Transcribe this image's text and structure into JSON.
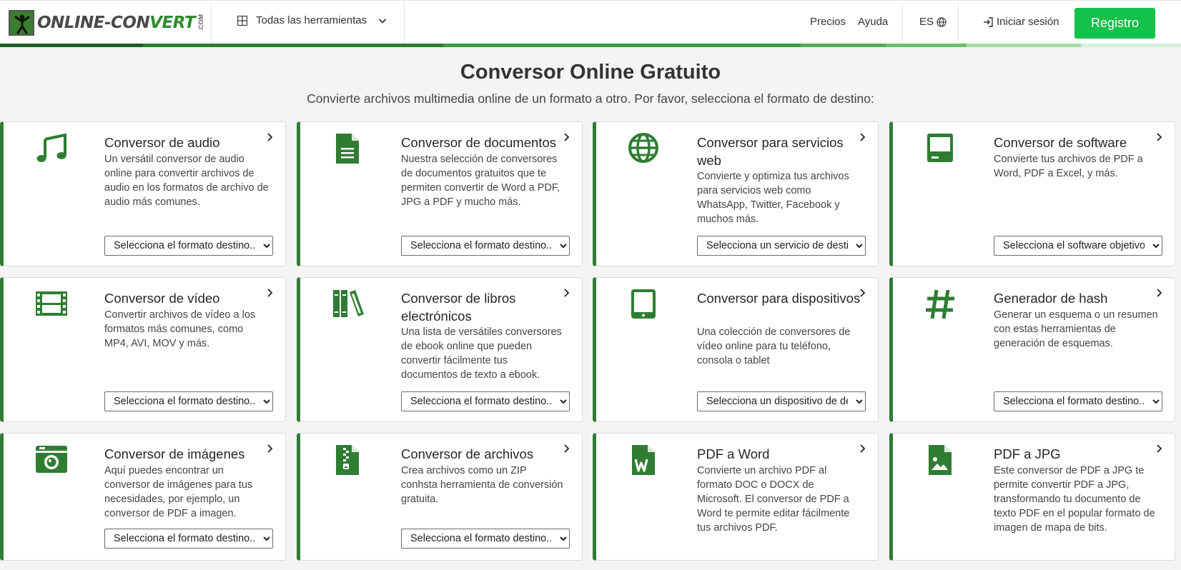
{
  "brand": {
    "name_part1": "ONLINE-CON",
    "name_part2": "VERT",
    "suffix": ".COM"
  },
  "header": {
    "tools_menu_label": "Todas las herramientas",
    "pricing_label": "Precios",
    "help_label": "Ayuda",
    "language_label": "ES",
    "login_label": "Iniciar sesión",
    "register_label": "Registro"
  },
  "colors": {
    "accent_green": "#2f7d32",
    "register_green": "#13c24a",
    "background": "#f4f4f4"
  },
  "hero": {
    "title": "Conversor Online Gratuito",
    "subtitle": "Convierte archivos multimedia online de un formato a otro. Por favor, selecciona el formato de destino:"
  },
  "cards": [
    {
      "icon": "music-note-icon",
      "title": "Conversor de audio",
      "description": "Un versátil conversor de audio online para convertir archivos de audio en los formatos de archivo de audio más comunes.",
      "select_placeholder": "Selecciona el formato destino..."
    },
    {
      "icon": "document-icon",
      "title": "Conversor de documentos",
      "description": "Nuestra selección de conversores de documentos gratuitos que te permiten convertir de Word a PDF, JPG a PDF y mucho más.",
      "select_placeholder": "Selecciona el formato destino..."
    },
    {
      "icon": "globe-icon",
      "title": "Conversor para servicios web",
      "description": "Convierte y optimiza tus archivos para servicios web como WhatsApp, Twitter, Facebook y muchos más.",
      "select_placeholder": "Selecciona un servicio de destino..."
    },
    {
      "icon": "computer-icon",
      "title": "Conversor de software",
      "description": "Convierte tus archivos de PDF a Word, PDF a Excel, y más.",
      "select_placeholder": "Selecciona el software objetivo..."
    },
    {
      "icon": "film-icon",
      "title": "Conversor de vídeo",
      "description": "Convertir archivos de vídeo a los formatos más comunes, como MP4, AVI, MOV y más.",
      "select_placeholder": "Selecciona el formato destino..."
    },
    {
      "icon": "books-icon",
      "title": "Conversor de libros electrónicos",
      "description": "Una lista de versátiles conversores de ebook online que pueden convertir fácilmente tus documentos de texto a ebook.",
      "select_placeholder": "Selecciona el formato destino..."
    },
    {
      "icon": "tablet-icon",
      "title": "Conversor para dispositivos",
      "description": "Una colección de conversores de vídeo online para tu teléfono, consola o tablet",
      "select_placeholder": "Selecciona un dispositivo de destino..."
    },
    {
      "icon": "hash-icon",
      "title": "Generador de hash",
      "description": "Generar un esquema o un resumen con estas herramientas de generación de esquemas.",
      "select_placeholder": "Selecciona el formato destino..."
    },
    {
      "icon": "camera-icon",
      "title": "Conversor de imágenes",
      "description": "Aquí puedes encontrar un conversor de imágenes para tus necesidades, por ejemplo, un conversor de PDF a imagen.",
      "select_placeholder": "Selecciona el formato destino..."
    },
    {
      "icon": "zip-file-icon",
      "title": "Conversor de archivos",
      "description": "Crea archivos como un ZIP conhsta herramienta de conversión gratuita.",
      "select_placeholder": "Selecciona el formato destino..."
    },
    {
      "icon": "word-file-icon",
      "title": "PDF a Word",
      "description": "Convierte un archivo PDF al formato DOC o DOCX de Microsoft. El conversor de PDF a Word te permite editar fácilmente tus archivos PDF."
    },
    {
      "icon": "image-file-icon",
      "title": "PDF a JPG",
      "description": "Este conversor de PDF a JPG te permite convertir PDF a JPG, transformando tu documento de texto PDF en el popular formato de imagen de mapa de bits."
    }
  ]
}
